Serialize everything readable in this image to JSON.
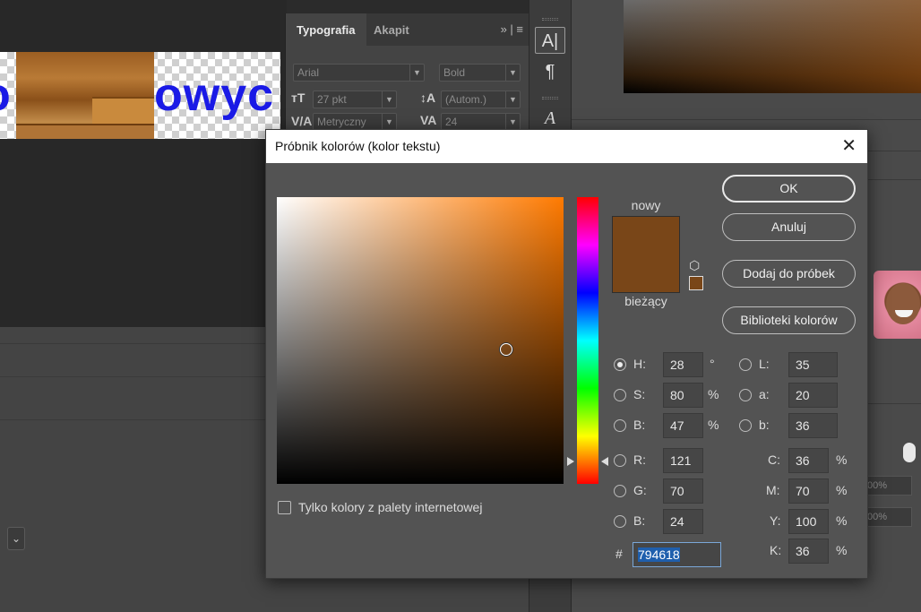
{
  "background": {
    "canvas_text": "owyc",
    "canvas_text_left": "o",
    "typography_panel": {
      "tabs": [
        "Typografia",
        "Akapit"
      ],
      "font_family": "Arial",
      "font_style": "Bold",
      "font_size": "27 pkt",
      "leading": "(Autom.)",
      "kerning": "Metryczny",
      "tracking": "24"
    },
    "right_fields": [
      "00%",
      "00%"
    ]
  },
  "dialog": {
    "title": "Próbnik kolorów (kolor tekstu)",
    "label_new": "nowy",
    "label_current": "bieżący",
    "new_color": "#794618",
    "current_color": "#794618",
    "buttons": {
      "ok": "OK",
      "cancel": "Anuluj",
      "add_to_swatches": "Dodaj do próbek",
      "color_libraries": "Biblioteki kolorów"
    },
    "web_colors_only": "Tylko kolory z palety internetowej",
    "hsb": {
      "h": {
        "label": "H:",
        "value": "28",
        "unit": "°"
      },
      "s": {
        "label": "S:",
        "value": "80",
        "unit": "%"
      },
      "b": {
        "label": "B:",
        "value": "47",
        "unit": "%"
      }
    },
    "rgb": {
      "r": {
        "label": "R:",
        "value": "121"
      },
      "g": {
        "label": "G:",
        "value": "70"
      },
      "b": {
        "label": "B:",
        "value": "24"
      }
    },
    "lab": {
      "l": {
        "label": "L:",
        "value": "35"
      },
      "a": {
        "label": "a:",
        "value": "20"
      },
      "b": {
        "label": "b:",
        "value": "36"
      }
    },
    "cmyk": {
      "c": {
        "label": "C:",
        "value": "36",
        "unit": "%"
      },
      "m": {
        "label": "M:",
        "value": "70",
        "unit": "%"
      },
      "y": {
        "label": "Y:",
        "value": "100",
        "unit": "%"
      },
      "k": {
        "label": "K:",
        "value": "36",
        "unit": "%"
      }
    },
    "hex_label": "#",
    "hex_value": "794618",
    "selected_mode": "H",
    "hue_degrees": 28,
    "saturation_fraction": 0.8,
    "brightness_fraction": 0.47,
    "icons": {
      "close": "close-icon",
      "gamut": "cube-icon"
    }
  }
}
